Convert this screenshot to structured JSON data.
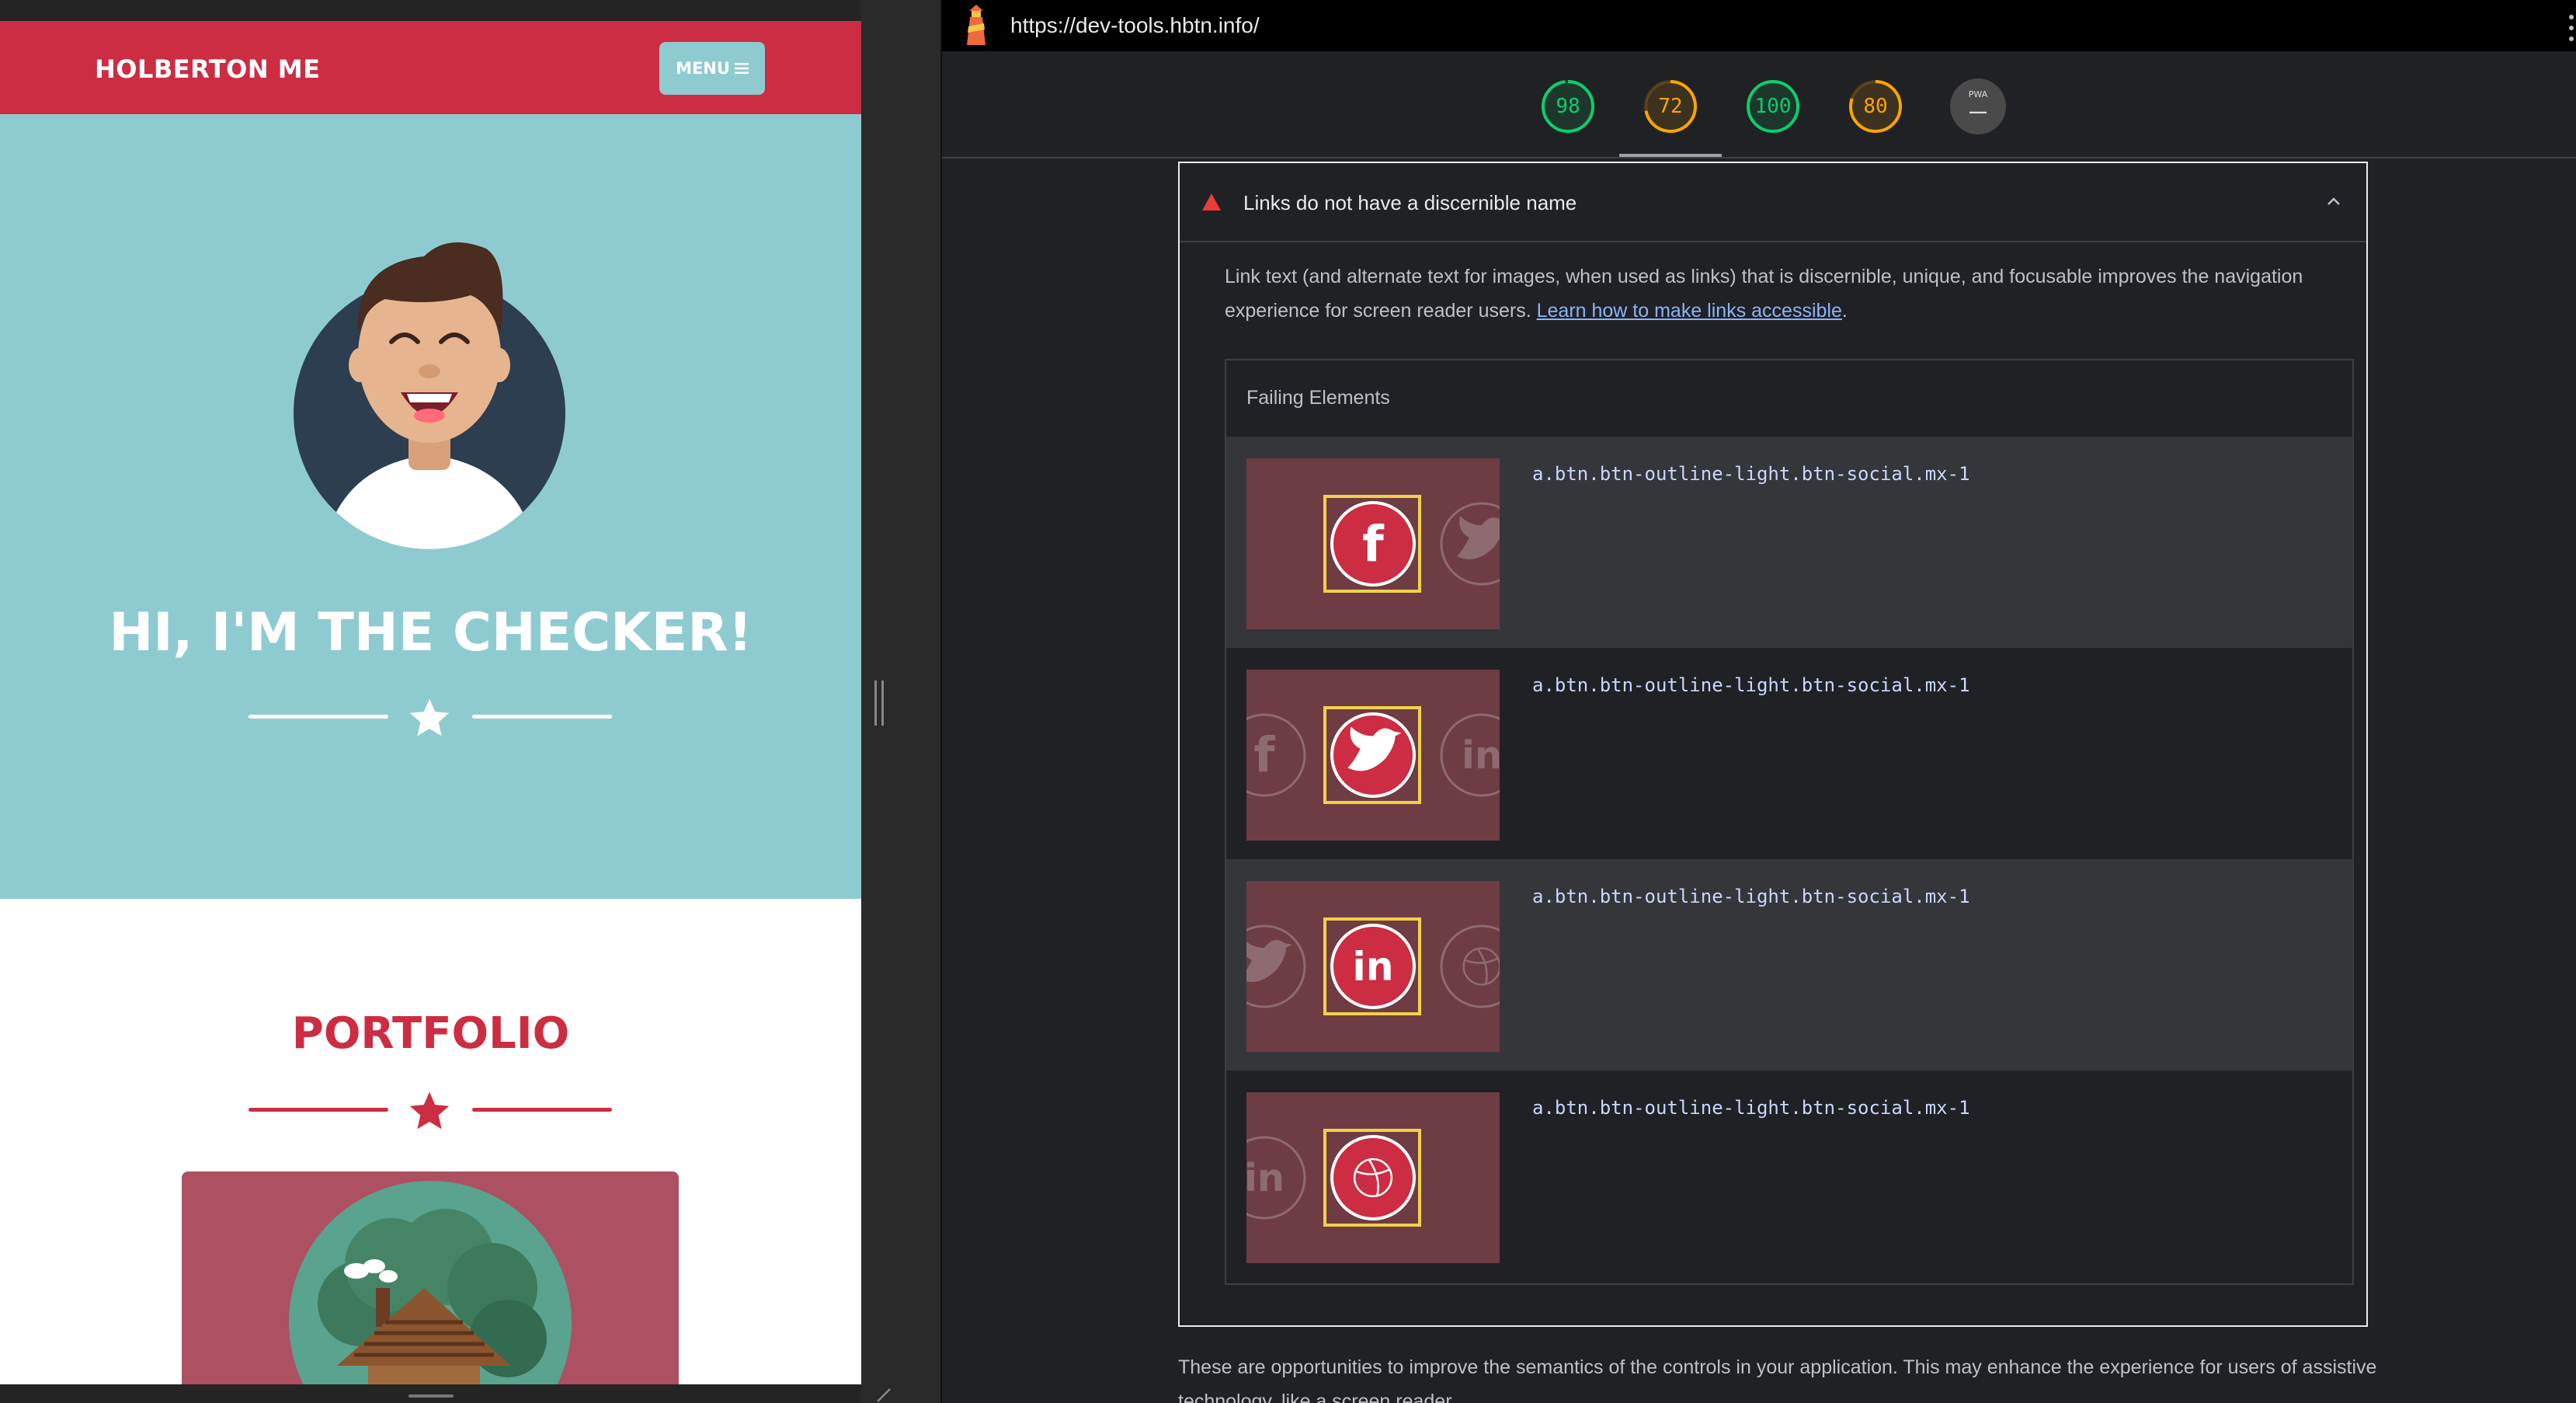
{
  "viewport": {
    "brand": "HOLBERTON ME",
    "menu_label": "MENU",
    "hero_title": "HI, I'M THE CHECKER!",
    "portfolio_title": "PORTFOLIO",
    "colors": {
      "brand_red": "#cc2d43",
      "hero_teal": "#8ecbd1"
    }
  },
  "panel": {
    "url": "https://dev-tools.hbtn.info/",
    "gauges": [
      {
        "value": "98",
        "color": "#0cce6b"
      },
      {
        "value": "72",
        "color": "#ffa400"
      },
      {
        "value": "100",
        "color": "#0cce6b"
      },
      {
        "value": "80",
        "color": "#ffa400"
      }
    ],
    "pwa_label": "PWA",
    "pwa_dash": "—",
    "audit": {
      "title": "Links do not have a discernible name",
      "description": "Link text (and alternate text for images, when used as links) that is discernible, unique, and focusable improves the navigation experience for screen reader users.",
      "link_text": "Learn how to make links accessible",
      "after_link": ".",
      "table_header": "Failing Elements",
      "rows": [
        {
          "selector": "a.btn.btn-outline-light.btn-social.mx-1",
          "icon": "facebook-icon",
          "label": "f"
        },
        {
          "selector": "a.btn.btn-outline-light.btn-social.mx-1",
          "icon": "twitter-icon",
          "label": ""
        },
        {
          "selector": "a.btn.btn-outline-light.btn-social.mx-1",
          "icon": "linkedin-icon",
          "label": "in"
        },
        {
          "selector": "a.btn.btn-outline-light.btn-social.mx-1",
          "icon": "dribbble-icon",
          "label": ""
        }
      ]
    },
    "footer_text": "These are opportunities to improve the semantics of the controls in your application. This may enhance the experience for users of assistive technology, like a screen reader."
  }
}
